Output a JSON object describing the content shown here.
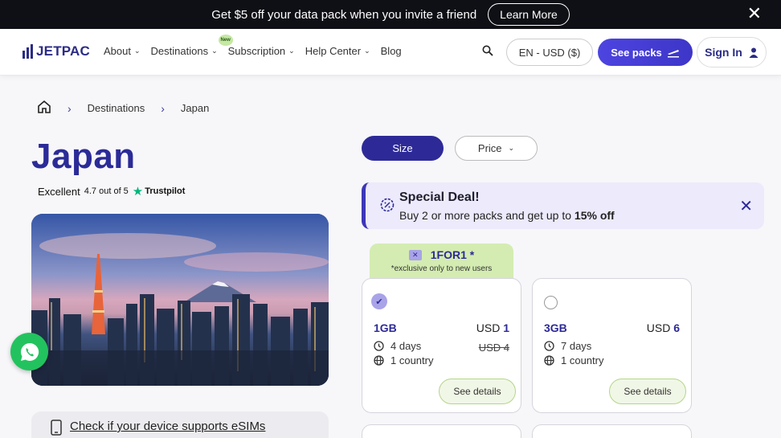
{
  "promo_bar": {
    "text": "Get $5 off your data pack when you invite a friend",
    "learn_more": "Learn More"
  },
  "nav": {
    "logo": "JETPAC",
    "menu": [
      {
        "label": "About",
        "has_dropdown": true
      },
      {
        "label": "Destinations",
        "has_dropdown": true
      },
      {
        "label": "Subscription",
        "has_dropdown": true,
        "badge": "New"
      },
      {
        "label": "Help Center",
        "has_dropdown": true
      },
      {
        "label": "Blog",
        "has_dropdown": false
      }
    ],
    "lang_currency": "EN - USD ($)",
    "see_packs": "See packs",
    "sign_in": "Sign In"
  },
  "breadcrumb": {
    "items": [
      "Destinations",
      "Japan"
    ]
  },
  "page": {
    "title": "Japan",
    "rating_label": "Excellent",
    "rating_score": "4.7 out of 5",
    "rating_provider": "Trustpilot"
  },
  "device_check": {
    "label": "Check if your device supports eSIMs"
  },
  "filters": {
    "size": "Size",
    "price": "Price"
  },
  "deal": {
    "title": "Special Deal!",
    "text_before": "Buy 2 or more packs and get up to ",
    "highlight": "15% off"
  },
  "promo_tag": {
    "code": "1FOR1 *",
    "note": "*exclusive only to new users"
  },
  "packs": [
    {
      "size": "1GB",
      "currency": "USD",
      "price": "1",
      "old_price": "USD 4",
      "days": "4 days",
      "countries": "1 country",
      "selected": true,
      "details": "See details"
    },
    {
      "size": "3GB",
      "currency": "USD",
      "price": "6",
      "old_price": "",
      "days": "7 days",
      "countries": "1 country",
      "selected": false,
      "details": "See details"
    }
  ],
  "colors": {
    "brand": "#2d2a98",
    "accent": "#4d44e0",
    "promo_green": "#d4ecb1",
    "whatsapp": "#22c35e"
  }
}
